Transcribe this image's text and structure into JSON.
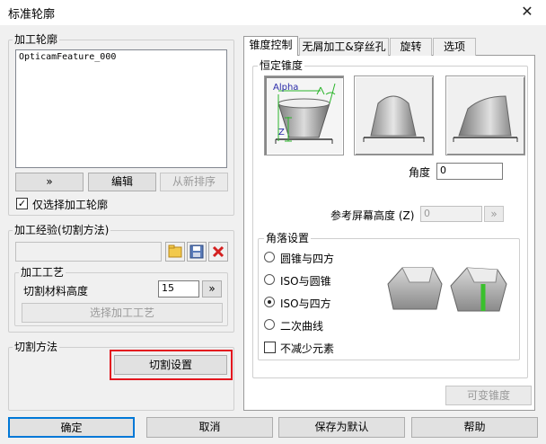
{
  "window": {
    "title": "标准轮廓",
    "close_glyph": "✕"
  },
  "left": {
    "contour_group": {
      "label": "加工轮廓",
      "list_items": [
        "OpticamFeature_000"
      ],
      "buttons": {
        "more": "»",
        "edit": "编辑",
        "reorder": "从新排序"
      },
      "only_select_label": "仅选择加工轮廓",
      "only_select_checked": true
    },
    "experience_group": {
      "label": "加工经验(切割方法)",
      "value": "",
      "icons": [
        "folder-icon",
        "save-icon",
        "delete-icon"
      ]
    },
    "process_group": {
      "label": "加工工艺",
      "height_label": "切割材料高度",
      "height_value": "15",
      "more": "»",
      "select_button": "选择加工工艺"
    },
    "cut_method_group": {
      "label": "切割方法",
      "settings_button": "切割设置"
    }
  },
  "tabs": [
    {
      "label": "锥度控制",
      "active": true
    },
    {
      "label": "无屑加工&穿丝孔",
      "active": false
    },
    {
      "label": "旋转",
      "active": false
    },
    {
      "label": "选项",
      "active": false
    }
  ],
  "taper": {
    "group_label": "恒定锥度",
    "diagram_labels": {
      "alpha": "Alpha",
      "z": "Z"
    },
    "angle_label": "角度",
    "angle_value": "0",
    "ref_height_label": "参考屏幕高度 (Z)",
    "ref_height_value": "0",
    "ref_more": "»",
    "corner_group_label": "角落设置",
    "corner_options": [
      {
        "label": "圆锥与四方",
        "selected": false
      },
      {
        "label": "ISO与圆锥",
        "selected": false
      },
      {
        "label": "ISO与四方",
        "selected": true
      },
      {
        "label": "二次曲线",
        "selected": false
      }
    ],
    "no_reduce_label": "不减少元素",
    "no_reduce_checked": false,
    "variable_taper_button": "可变锥度"
  },
  "footer": {
    "ok": "确定",
    "cancel": "取消",
    "save_default": "保存为默认",
    "help": "帮助"
  },
  "colors": {
    "highlight_red": "#e3161e",
    "green_edge": "#39c02c"
  }
}
